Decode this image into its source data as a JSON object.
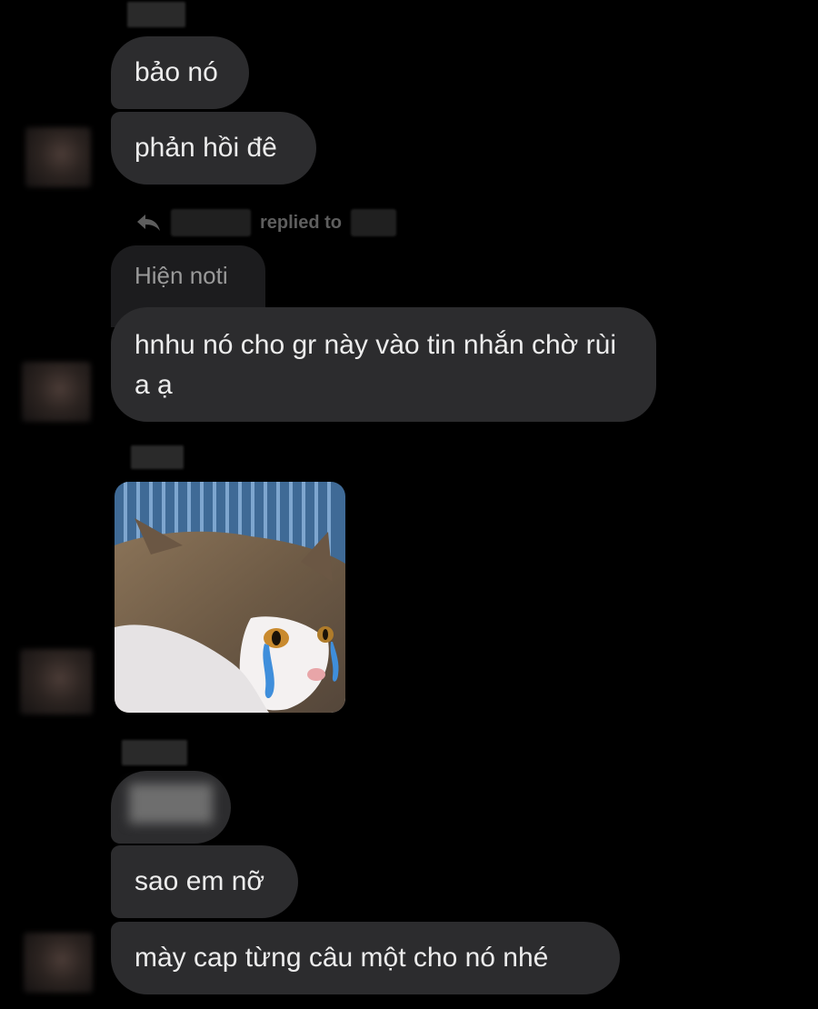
{
  "conversation": {
    "reply_header": {
      "label": "replied to"
    },
    "messages": [
      {
        "text": "bảo nó"
      },
      {
        "text": "phản hồi đê"
      },
      {
        "quoted_text": "Hiện noti",
        "text": "hnhu nó cho gr này vào tin nhắn chờ rùi a ạ"
      },
      {
        "sticker": "crying-cat-sticker"
      },
      {
        "text": "sao em nỡ"
      },
      {
        "text": "mày cap từng câu một cho nó nhé"
      }
    ]
  },
  "colors": {
    "background": "#000000",
    "bubble": "#2c2c2e",
    "quoted_bubble": "#1c1c1e",
    "text": "#ececec",
    "muted": "#5e5e5e"
  }
}
